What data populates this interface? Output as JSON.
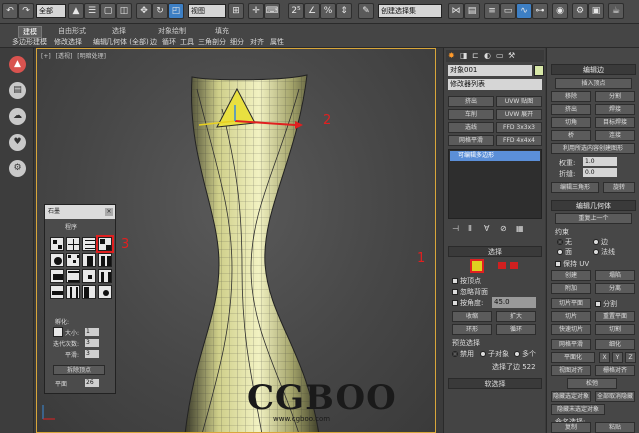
{
  "toolbar": {
    "filter_select": "全部",
    "view_select": "视图",
    "percent_label": "%",
    "selection_set": "创建选择集",
    "icons": [
      "undo-icon",
      "redo-icon",
      "link-icon",
      "unlink-icon",
      "bind-icon",
      "select-icon",
      "select-region-icon",
      "select-by-name-icon",
      "window-crossing-icon",
      "move-icon",
      "rotate-icon",
      "scale-icon",
      "pivot-icon",
      "snap-icon",
      "angle-snap-icon",
      "percent-snap-icon",
      "spinner-snap-icon",
      "edit-named-sets-icon",
      "mirror-icon",
      "align-icon",
      "layer-icon",
      "curve-editor-icon",
      "schematic-icon",
      "material-editor-icon",
      "render-setup-icon",
      "render-frame-icon",
      "render-icon"
    ]
  },
  "ribbon": {
    "tabs": [
      "建模",
      "自由形式",
      "选择",
      "对象绘制",
      "填充"
    ],
    "items": [
      "多边形建模",
      "修改选择",
      "编辑",
      "几何体 (全部)",
      "边",
      "循环",
      "工具",
      "三角剖分",
      "细分",
      "对齐",
      "属性"
    ]
  },
  "dock_icons": [
    "app-logo-icon",
    "document-icon",
    "cloud-icon",
    "heart-icon",
    "settings-icon"
  ],
  "viewport": {
    "labels": [
      "[+]",
      "[透视]",
      "[明暗处理]"
    ],
    "callouts": [
      "1",
      "2",
      "3"
    ],
    "watermark": "CGBOO",
    "watermark_url": "www.cgboo.com"
  },
  "float_panel": {
    "title": "石墨",
    "section": "程序",
    "fixed_label": "孵化:",
    "size_label": "大小:",
    "size_value": "1",
    "iter_label": "迭代次数:",
    "iter_value": "3",
    "smooth_label": "平滑:",
    "smooth_value": "3",
    "button_label": "拆除顶点",
    "plane_label": "平面",
    "plane_value": "26"
  },
  "command_panel": {
    "object_name": "对象001",
    "modifier_list": "修改器列表",
    "buttons": [
      "挤出",
      "UVW 贴图",
      "车削",
      "UVW 展开",
      "选线",
      "FFD 3x3x3",
      "网格平滑",
      "FFD 4x4x4"
    ],
    "stack_item": "可编辑多边形",
    "selection_header": "选择",
    "by_vertex": "按顶点",
    "ignore_back": "忽略背面",
    "by_angle": "按角度:",
    "angle_value": "45.0",
    "shrink": "收缩",
    "grow": "扩大",
    "ring": "环形",
    "loop": "循环",
    "preview_label": "预览选择",
    "preview_options": [
      "禁用",
      "子对象",
      "多个"
    ],
    "status": "选择了边 522",
    "soft_select": "软选择"
  },
  "right_panel": {
    "edit_edges_header": "编辑边",
    "insert_vertex": "插入顶点",
    "remove": "移除",
    "split": "分割",
    "extrude": "挤出",
    "weld": "焊接",
    "chamfer": "切角",
    "target_weld": "目标焊接",
    "bridge": "桥",
    "connect": "连接",
    "create_shape": "利用所选内容创建图形",
    "weight_label": "权重:",
    "weight_value": "1.0",
    "crease_label": "折缝:",
    "crease_value": "0.0",
    "edit_tri": "编辑三角形",
    "rotate": "旋转",
    "edit_geo_header": "编辑几何体",
    "repeat_last": "重复上一个",
    "constraints_label": "约束",
    "c_none": "无",
    "c_edge": "边",
    "c_face": "面",
    "c_normal": "法线",
    "preserve_uv": "保持 UV",
    "create": "创建",
    "collapse": "塌陷",
    "attach": "附加",
    "detach": "分离",
    "slice_plane": "切片平面",
    "split2": "分割",
    "slice": "切片",
    "reset_plane": "重置平面",
    "quickslice": "快速切片",
    "cut": "切割",
    "meshsmooth": "网格平滑",
    "tessellate": "细化",
    "planarize": "平面化",
    "x": "X",
    "y": "Y",
    "z": "Z",
    "view_align": "视图对齐",
    "grid_align": "栅格对齐",
    "relax": "松弛",
    "hide_sel": "隐藏选定对象",
    "unhide_all": "全部取消隐藏",
    "hide_unsel": "隐藏未选定对象",
    "named_sel": "命名选择:",
    "copy": "复制",
    "paste": "粘贴"
  }
}
